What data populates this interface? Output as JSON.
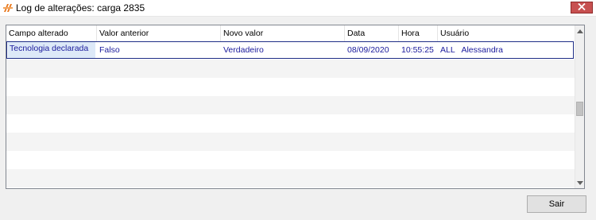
{
  "window": {
    "title": "Log de alterações: carga 2835",
    "icon": "app-logo-icon",
    "close_icon": "close-icon"
  },
  "grid": {
    "columns": [
      "Campo alterado",
      "Valor anterior",
      "Novo valor",
      "Data",
      "Hora",
      "Usuário"
    ],
    "rows": [
      {
        "campo": "Tecnologia declarada",
        "valor_anterior": "Falso",
        "novo_valor": "Verdadeiro",
        "data": "08/09/2020",
        "hora": "10:55:25",
        "usuario": "ALL   Alessandra"
      }
    ]
  },
  "footer": {
    "exit_label": "Sair"
  },
  "colors": {
    "selection_border": "#1f2e86",
    "cell_text": "#1a1a9c",
    "close_button": "#c75050"
  }
}
